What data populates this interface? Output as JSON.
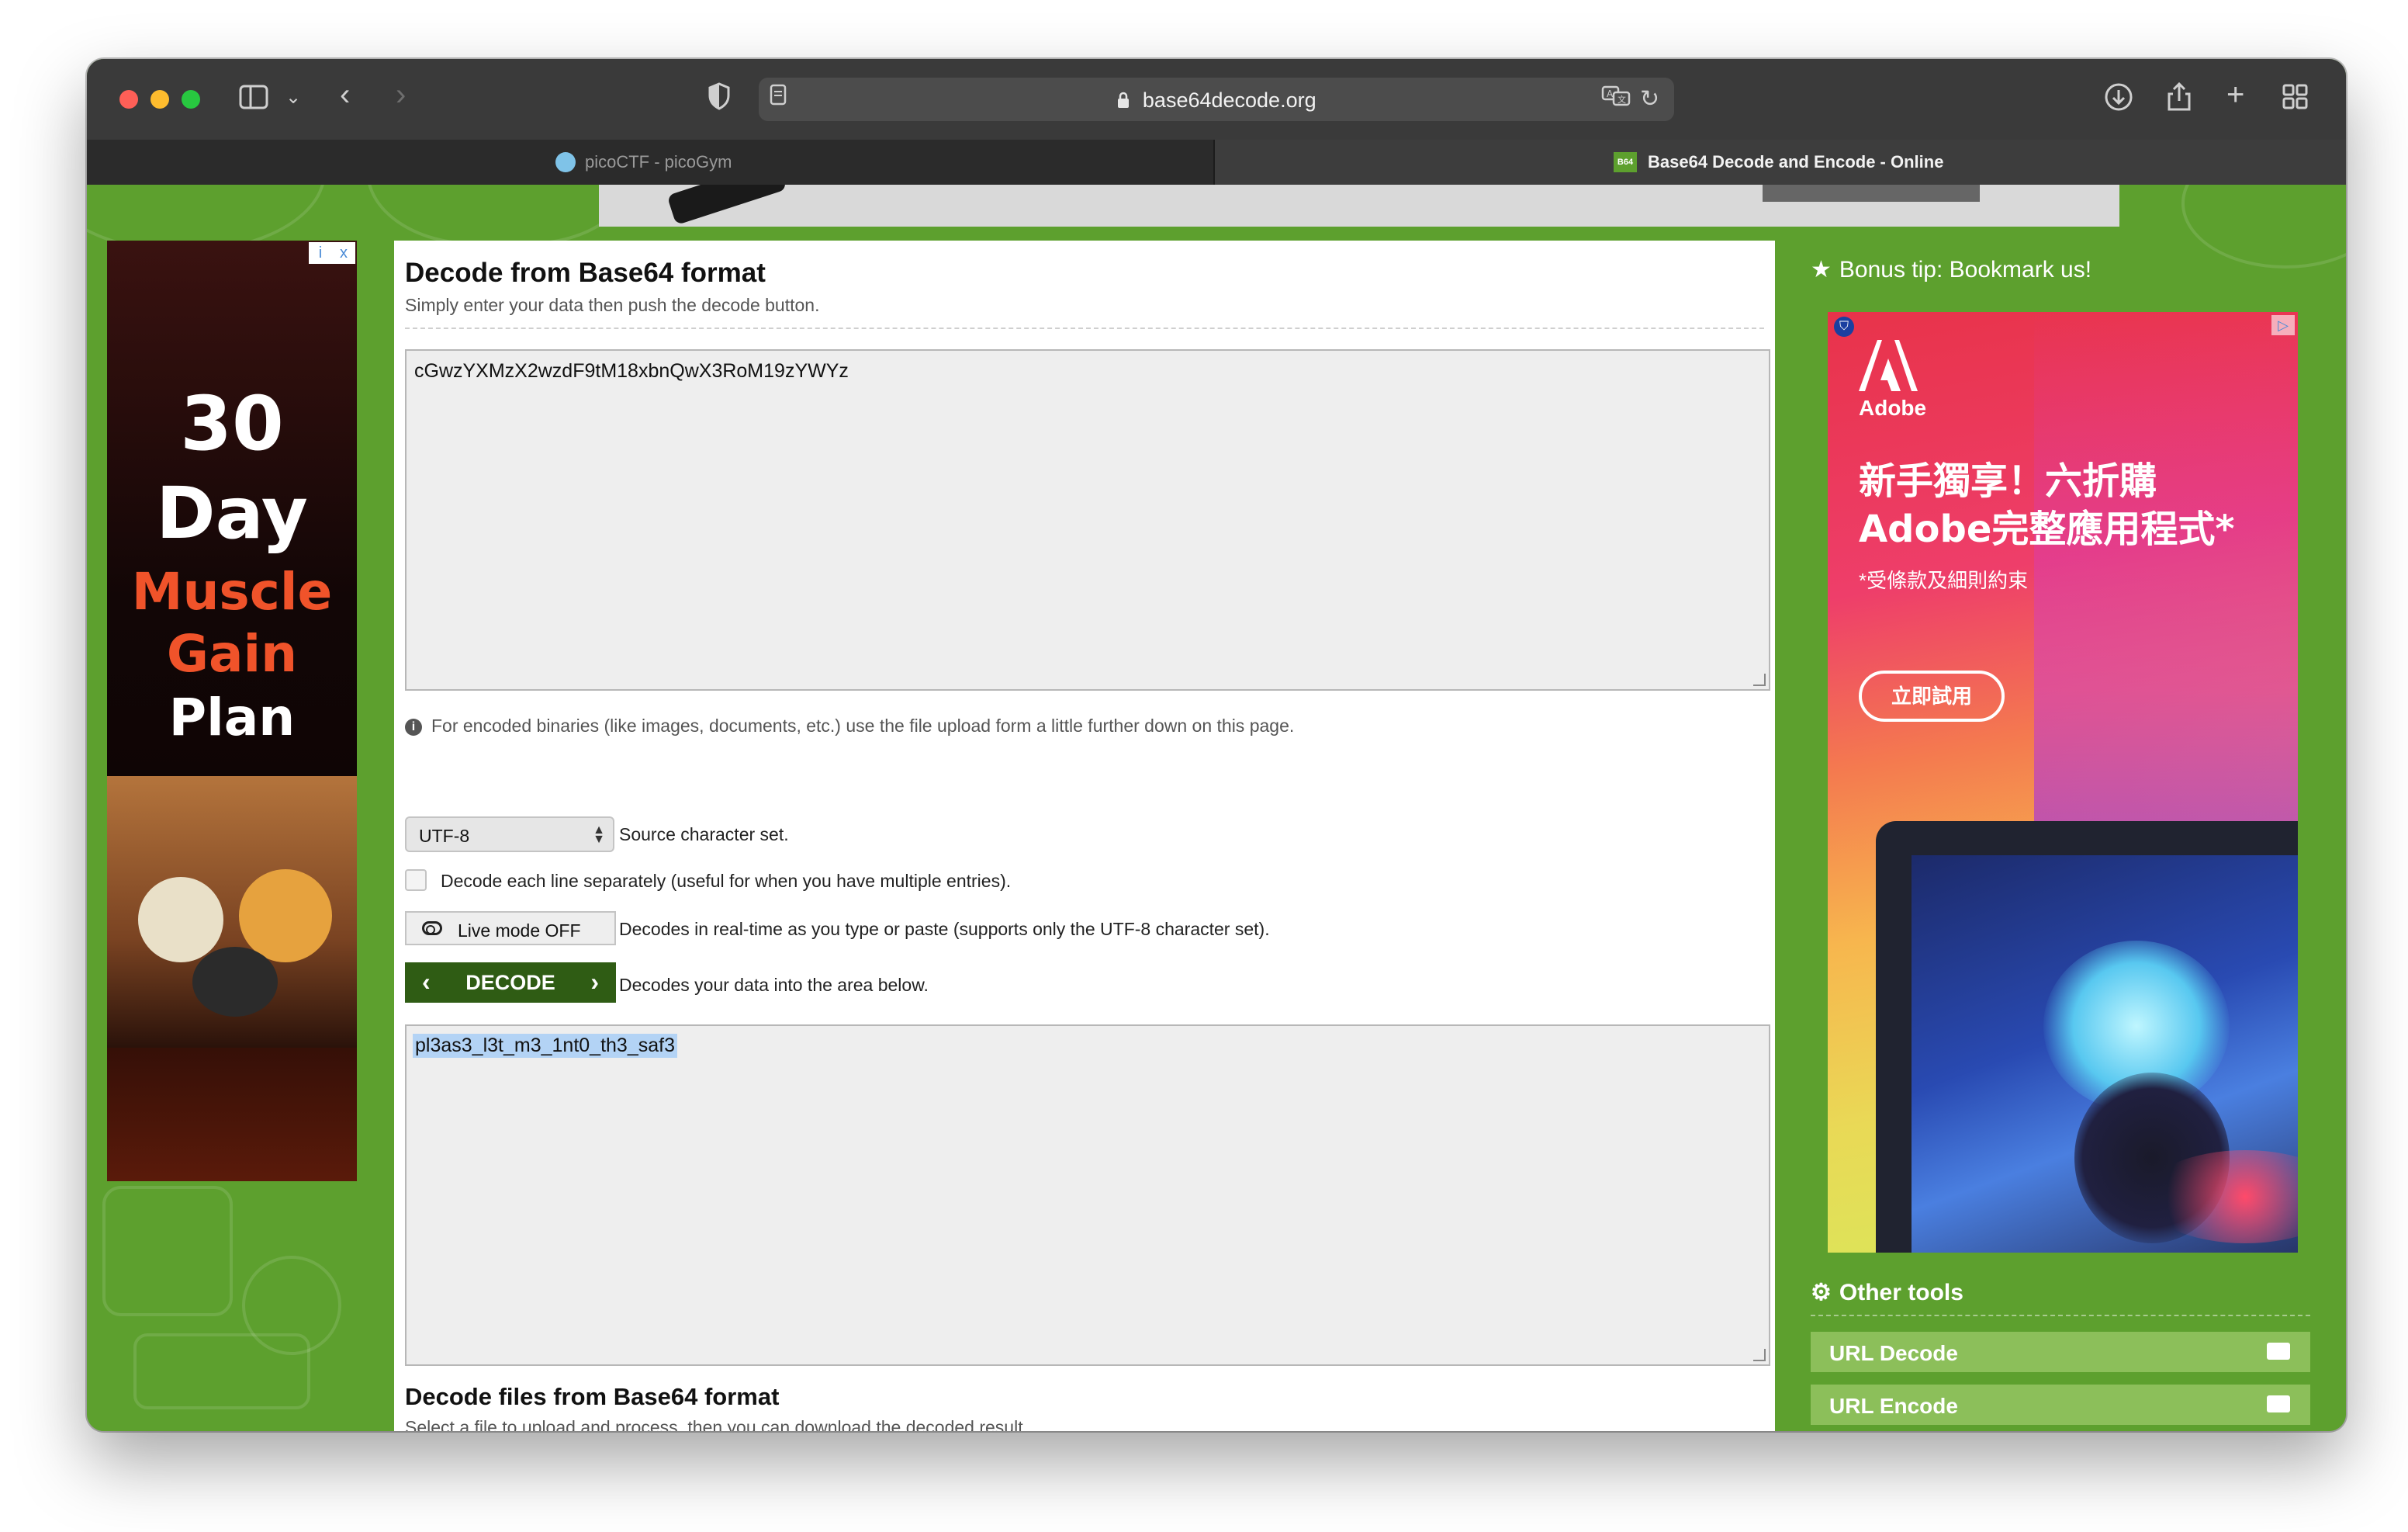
{
  "browser": {
    "url": "base64decode.org",
    "tabs": [
      {
        "label": "picoCTF - picoGym",
        "active": false
      },
      {
        "label": "Base64 Decode and Encode - Online",
        "active": true,
        "favicon_text": "B64"
      }
    ]
  },
  "left_ad": {
    "line1": "30",
    "line2": "Day",
    "line3": "Muscle",
    "line4": "Gain",
    "line5": "Plan",
    "choice_i": "i",
    "choice_x": "x"
  },
  "main": {
    "title": "Decode from Base64 format",
    "subtitle": "Simply enter your data then push the decode button.",
    "input_value": "cGwzYXMzX2wzdF9tM18xbnQwX3RoM19zYWYz",
    "binary_note": "For encoded binaries (like images, documents, etc.) use the file upload form a little further down on this page.",
    "charset": {
      "value": "UTF-8",
      "label": "Source character set."
    },
    "each_line": {
      "label": "Decode each line separately (useful for when you have multiple entries)."
    },
    "live_mode": {
      "button": "Live mode OFF",
      "label": "Decodes in real-time as you type or paste (supports only the UTF-8 character set)."
    },
    "decode": {
      "button": "DECODE",
      "label": "Decodes your data into the area below."
    },
    "output_value": "pl3as3_l3t_m3_1nt0_th3_saf3",
    "files_title": "Decode files from Base64 format",
    "files_subtitle": "Select a file to upload and process, then you can download the decoded result."
  },
  "right": {
    "bonus": "Bonus tip: Bookmark us!",
    "adobe_ad": {
      "brand": "Adobe",
      "headline1": "新手獨享！六折購",
      "headline2": "Adobe完整應用程式*",
      "fine_print": "*受條款及細則約束",
      "cta": "立即試用"
    },
    "other_tools_title": "Other tools",
    "tools": [
      "URL Decode",
      "URL Encode"
    ]
  },
  "colors": {
    "page_green": "#5da02e",
    "decode_button": "#2f5c14",
    "tool_button": "#8cbf5a"
  }
}
